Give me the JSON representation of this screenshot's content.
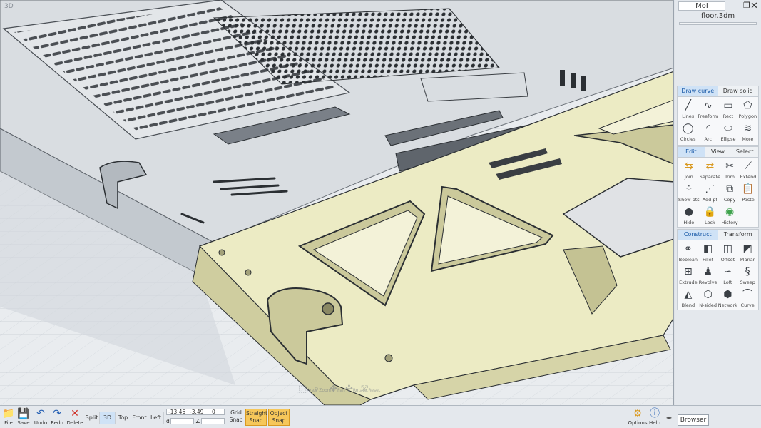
{
  "app": {
    "title": "MoI",
    "filename": "floor.3dm"
  },
  "viewport": {
    "label": "3D",
    "nav_tools": [
      {
        "icon": "zoom-area-icon",
        "label": "Area"
      },
      {
        "icon": "zoom-icon",
        "label": "Zoom"
      },
      {
        "icon": "pan-icon",
        "label": "Pan"
      },
      {
        "icon": "rotate-icon",
        "label": "Rotate"
      },
      {
        "icon": "reset-icon",
        "label": "Reset"
      }
    ]
  },
  "panel": {
    "draw": {
      "tabs": [
        "Draw curve",
        "Draw solid"
      ],
      "tools": [
        {
          "icon": "lines-icon",
          "label": "Lines"
        },
        {
          "icon": "freeform-icon",
          "label": "Freeform"
        },
        {
          "icon": "rect-icon",
          "label": "Rect"
        },
        {
          "icon": "polygon-icon",
          "label": "Polygon"
        },
        {
          "icon": "circles-icon",
          "label": "Circles"
        },
        {
          "icon": "arc-icon",
          "label": "Arc"
        },
        {
          "icon": "ellipse-icon",
          "label": "Ellipse"
        },
        {
          "icon": "more-icon",
          "label": "More"
        }
      ]
    },
    "edit": {
      "tabs": [
        "Edit",
        "View",
        "Select"
      ],
      "tools": [
        {
          "icon": "join-icon",
          "label": "Join"
        },
        {
          "icon": "separate-icon",
          "label": "Separate"
        },
        {
          "icon": "trim-icon",
          "label": "Trim"
        },
        {
          "icon": "extend-icon",
          "label": "Extend"
        },
        {
          "icon": "show-pts-icon",
          "label": "Show pts"
        },
        {
          "icon": "add-pt-icon",
          "label": "Add pt"
        },
        {
          "icon": "copy-icon",
          "label": "Copy"
        },
        {
          "icon": "paste-icon",
          "label": "Paste"
        },
        {
          "icon": "hide-icon",
          "label": "Hide"
        },
        {
          "icon": "lock-icon",
          "label": "Lock"
        },
        {
          "icon": "history-icon",
          "label": "History"
        }
      ]
    },
    "construct": {
      "tabs": [
        "Construct",
        "Transform"
      ],
      "tools": [
        {
          "icon": "boolean-icon",
          "label": "Boolean"
        },
        {
          "icon": "fillet-icon",
          "label": "Fillet"
        },
        {
          "icon": "offset-icon",
          "label": "Offset"
        },
        {
          "icon": "planar-icon",
          "label": "Planar"
        },
        {
          "icon": "extrude-icon",
          "label": "Extrude"
        },
        {
          "icon": "revolve-icon",
          "label": "Revolve"
        },
        {
          "icon": "loft-icon",
          "label": "Loft"
        },
        {
          "icon": "sweep-icon",
          "label": "Sweep"
        },
        {
          "icon": "blend-icon",
          "label": "Blend"
        },
        {
          "icon": "nsided-icon",
          "label": "N-sided"
        },
        {
          "icon": "network-icon",
          "label": "Network"
        },
        {
          "icon": "curve-icon",
          "label": "Curve"
        }
      ]
    }
  },
  "bottombar": {
    "file": "File",
    "save": "Save",
    "undo": "Undo",
    "redo": "Redo",
    "delete": "Delete",
    "views": [
      "Split",
      "3D",
      "Top",
      "Front",
      "Left"
    ],
    "coords": {
      "x": "-13.46",
      "y": "-3.49",
      "z": "0",
      "d_label": "d",
      "angle_label": "∠"
    },
    "grid_snap": [
      "Grid",
      "Snap"
    ],
    "straight_snap": [
      "Straight",
      "Snap"
    ],
    "object_snap": [
      "Object",
      "Snap"
    ],
    "options": "Options",
    "help": "Help",
    "browser": "Browser"
  },
  "colors": {
    "accent": "#1a5aa8",
    "active_tab": "#cfe2f6",
    "snap_on": "#f6c75a",
    "model_face": "#ecebc4",
    "model_ghost": "#d9dde1"
  }
}
